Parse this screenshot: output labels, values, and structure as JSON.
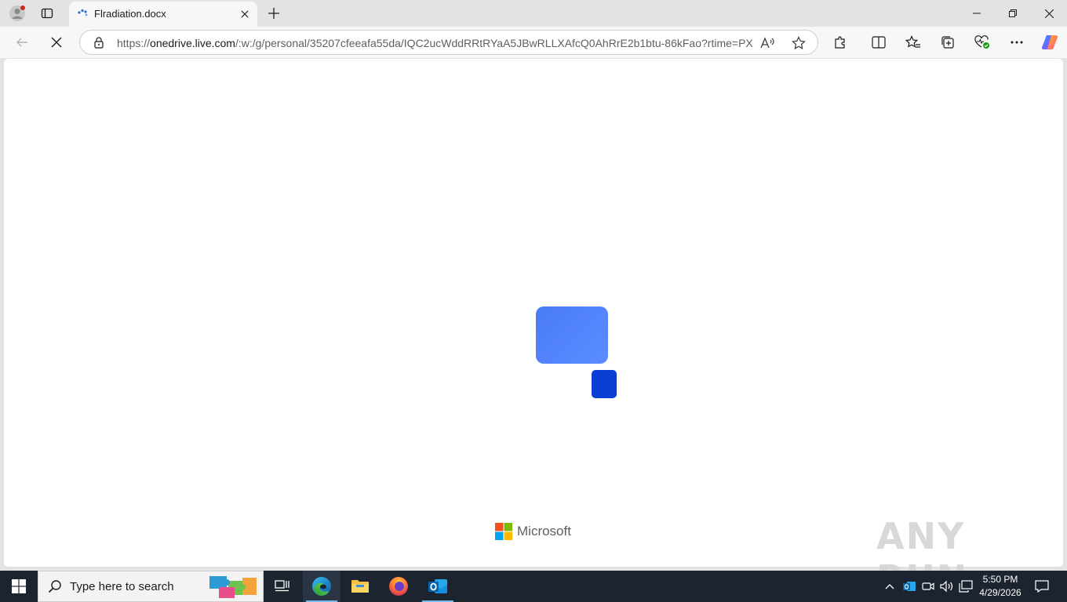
{
  "browser": {
    "tab": {
      "title": "Flradiation.docx"
    },
    "address_bar": {
      "protocol": "https://",
      "host": "onedrive.live.com",
      "path": "/:w:/g/personal/35207cfeeafa55da/IQC2ucWddRRtRYaA5JBwRLLXAfcQ0AhRrE2b1btu-86kFao?rtime=PX..."
    }
  },
  "page": {
    "brand": "Microsoft",
    "loader_colors": {
      "large": "#4a7bf7",
      "small": "#0a3fd6"
    },
    "watermark": "ANY RUN"
  },
  "taskbar": {
    "search_placeholder": "Type here to search",
    "time": "5:50 PM",
    "date": "4/29/2026",
    "apps": [
      "task-view",
      "edge",
      "file-explorer",
      "firefox",
      "outlook"
    ]
  }
}
